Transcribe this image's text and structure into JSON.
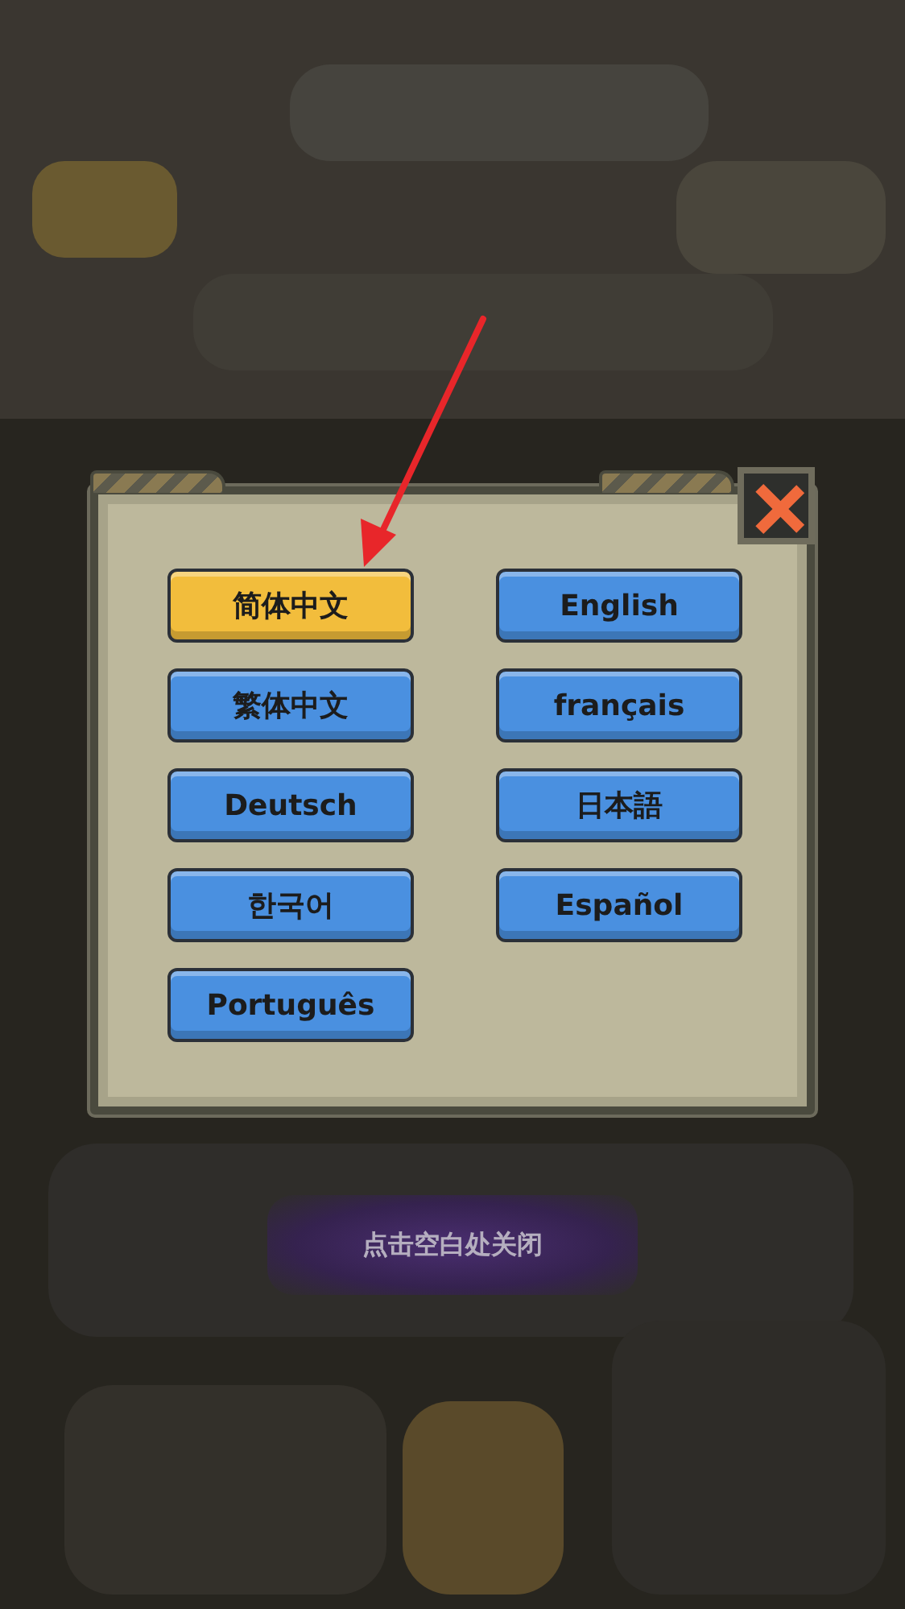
{
  "languages": [
    {
      "label": "简体中文",
      "selected": true
    },
    {
      "label": "English",
      "selected": false
    },
    {
      "label": "繁体中文",
      "selected": false
    },
    {
      "label": "français",
      "selected": false
    },
    {
      "label": "Deutsch",
      "selected": false
    },
    {
      "label": "日本語",
      "selected": false
    },
    {
      "label": "한국어",
      "selected": false
    },
    {
      "label": "Español",
      "selected": false
    },
    {
      "label": "Português",
      "selected": false
    }
  ],
  "dismiss_hint": "点击空白处关闭"
}
